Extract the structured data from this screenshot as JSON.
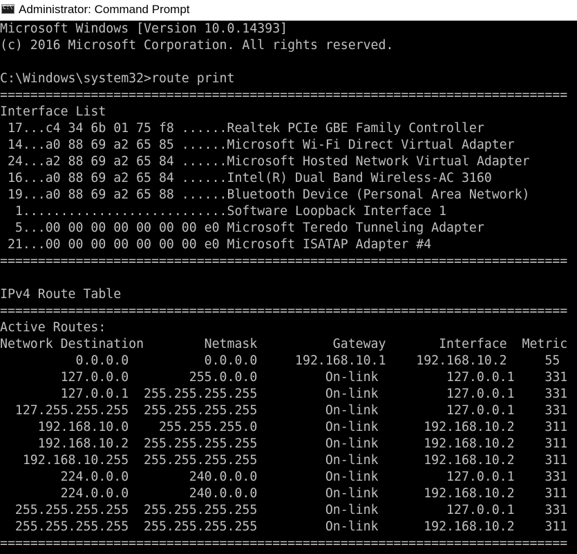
{
  "window": {
    "title": "Administrator: Command Prompt",
    "icon": "cmd-icon",
    "icon_glyph": "C:\\"
  },
  "colors": {
    "background": "#000000",
    "text": "#c0c0c0"
  },
  "console": {
    "banner": [
      "Microsoft Windows [Version 10.0.14393]",
      "(c) 2016 Microsoft Corporation. All rights reserved."
    ],
    "prompt_command": "C:\\Windows\\system32>route print",
    "separator": "===========================================================================",
    "interface_list_heading": "Interface List",
    "interfaces": [
      " 17...c4 34 6b 01 75 f8 ......Realtek PCIe GBE Family Controller",
      " 14...a0 88 69 a2 65 85 ......Microsoft Wi-Fi Direct Virtual Adapter",
      " 24...a2 88 69 a2 65 84 ......Microsoft Hosted Network Virtual Adapter",
      " 16...a0 88 69 a2 65 84 ......Intel(R) Dual Band Wireless-AC 3160",
      " 19...a0 88 69 a2 65 88 ......Bluetooth Device (Personal Area Network)",
      "  1...........................Software Loopback Interface 1",
      "  5...00 00 00 00 00 00 00 e0 Microsoft Teredo Tunneling Adapter",
      " 21...00 00 00 00 00 00 00 e0 Microsoft ISATAP Adapter #4"
    ],
    "ipv4_heading": "IPv4 Route Table",
    "active_routes_heading": "Active Routes:",
    "routes_header": "Network Destination        Netmask          Gateway       Interface  Metric",
    "routes": [
      "          0.0.0.0          0.0.0.0     192.168.10.1    192.168.10.2     55",
      "        127.0.0.0        255.0.0.0         On-link         127.0.0.1    331",
      "        127.0.0.1  255.255.255.255         On-link         127.0.0.1    331",
      "  127.255.255.255  255.255.255.255         On-link         127.0.0.1    331",
      "     192.168.10.0    255.255.255.0         On-link      192.168.10.2    311",
      "     192.168.10.2  255.255.255.255         On-link      192.168.10.2    311",
      "   192.168.10.255  255.255.255.255         On-link      192.168.10.2    311",
      "        224.0.0.0        240.0.0.0         On-link         127.0.0.1    331",
      "        224.0.0.0        240.0.0.0         On-link      192.168.10.2    311",
      "  255.255.255.255  255.255.255.255         On-link         127.0.0.1    331",
      "  255.255.255.255  255.255.255.255         On-link      192.168.10.2    311"
    ]
  }
}
